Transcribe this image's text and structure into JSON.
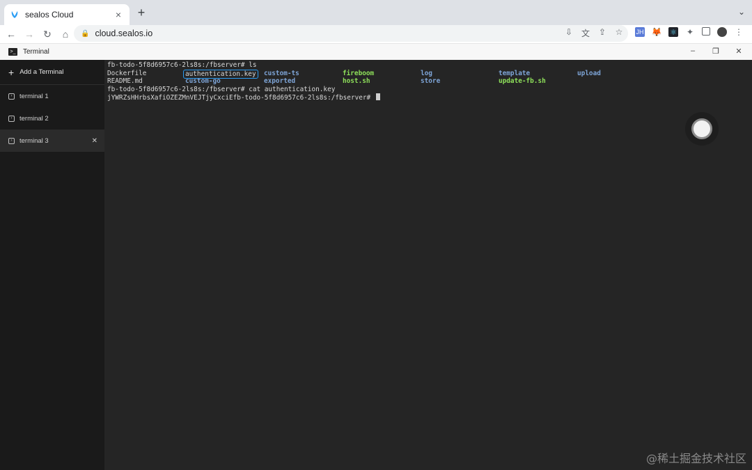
{
  "browser": {
    "tab_title": "sealos Cloud",
    "new_tab_label": "+",
    "url": "cloud.sealos.io"
  },
  "app": {
    "title": "Terminal"
  },
  "sidebar": {
    "add_label": "Add a Terminal",
    "items": [
      {
        "label": "terminal 1"
      },
      {
        "label": "terminal 2"
      },
      {
        "label": "terminal 3"
      }
    ]
  },
  "terminal": {
    "prompt1": "fb-todo-5f8d6957c6-2ls8s:/fbserver# ls",
    "ls_row1": [
      "Dockerfile",
      "authentication.key",
      "custom-ts",
      "fireboom",
      "log",
      "template",
      "upload"
    ],
    "ls_row2": [
      "README.md",
      "custom-go",
      "exported",
      "host.sh",
      "store",
      "update-fb.sh"
    ],
    "prompt2": "fb-todo-5f8d6957c6-2ls8s:/fbserver# cat authentication.key",
    "output": "jYWRZsHHrbsXafiOZEZMnVEJTjyCxciEfb-todo-5f8d6957c6-2ls8s:/fbserver# "
  },
  "watermark": "@稀土掘金技术社区",
  "colors": {
    "directory": "#7ea5d8",
    "executable": "#8ee05a",
    "highlight": "#2a9df4"
  }
}
